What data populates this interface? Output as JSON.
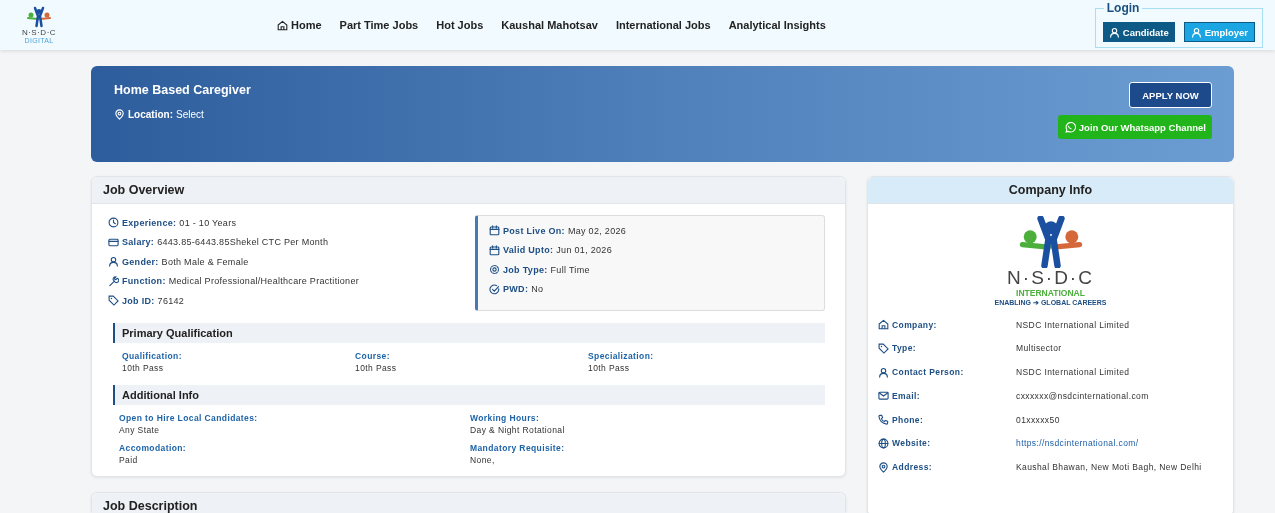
{
  "header": {
    "logo": {
      "wordmark": "N·S·D·C",
      "tagline": "DIGITAL"
    },
    "nav": [
      {
        "label": "Home"
      },
      {
        "label": "Part Time Jobs"
      },
      {
        "label": "Hot Jobs"
      },
      {
        "label": "Kaushal Mahotsav"
      },
      {
        "label": "International Jobs"
      },
      {
        "label": "Analytical Insights"
      }
    ],
    "login": {
      "legend": "Login",
      "buttons": [
        {
          "label": "Candidate",
          "kind": "candidate"
        },
        {
          "label": "Employer",
          "kind": "employer"
        }
      ]
    }
  },
  "banner": {
    "title": "Home Based Caregiver",
    "location_label": "Location:",
    "location_value": "Select",
    "apply": "APPLY NOW",
    "whatsapp": "Join Our Whatsapp Channel"
  },
  "job_overview": {
    "title": "Job Overview",
    "details": [
      {
        "label": "Experience:",
        "value": "01 - 10 Years"
      },
      {
        "label": "Salary:",
        "value": "6443.85-6443.85Shekel CTC Per Month"
      },
      {
        "label": "Gender:",
        "value": "Both Male & Female"
      },
      {
        "label": "Function:",
        "value": "Medical Professional/Healthcare Practitioner"
      },
      {
        "label": "Job ID:",
        "value": "76142"
      }
    ],
    "dates": [
      {
        "label": "Post Live On:",
        "value": "May 02, 2026"
      },
      {
        "label": "Valid Upto:",
        "value": "Jun 01, 2026"
      },
      {
        "label": "Job Type:",
        "value": "Full Time"
      },
      {
        "label": "PWD:",
        "value": "No"
      }
    ],
    "sections": [
      {
        "title": "Primary Qualification",
        "fields": [
          {
            "label": "Qualification:",
            "value": "10th Pass"
          },
          {
            "label": "Course:",
            "value": "10th Pass"
          },
          {
            "label": "Specialization:",
            "value": "10th Pass"
          }
        ]
      },
      {
        "title": "Additional Info",
        "fields": [
          {
            "label": "Open to Hire Local Candidates:",
            "value": "Any State"
          },
          {
            "label": "Working Hours:",
            "value": "Day & Night Rotational"
          },
          {
            "label": "Accomodation:",
            "value": "Paid"
          },
          {
            "label": "Mandatory Requisite:",
            "value": "None,"
          }
        ]
      }
    ]
  },
  "job_description": {
    "title": "Job Description"
  },
  "company_info": {
    "title": "Company Info",
    "logo": {
      "wordmark": "N·S·D·C",
      "line": "INTERNATIONAL",
      "tagline": "ENABLING ➔ GLOBAL CAREERS"
    },
    "rows": [
      {
        "label": "Company:",
        "value": "NSDC International Limited",
        "link": false
      },
      {
        "label": "Type:",
        "value": "Multisector",
        "link": false
      },
      {
        "label": "Contact Person:",
        "value": "NSDC International Limited",
        "link": false
      },
      {
        "label": "Email:",
        "value": "cxxxxxx@nsdcinternational.com",
        "link": false
      },
      {
        "label": "Phone:",
        "value": "01xxxxx50",
        "link": false
      },
      {
        "label": "Website:",
        "value": "https://nsdcinternational.com/",
        "link": true
      },
      {
        "label": "Address:",
        "value": "Kaushal Bhawan, New Moti Bagh, New Delhi",
        "link": false
      }
    ]
  }
}
